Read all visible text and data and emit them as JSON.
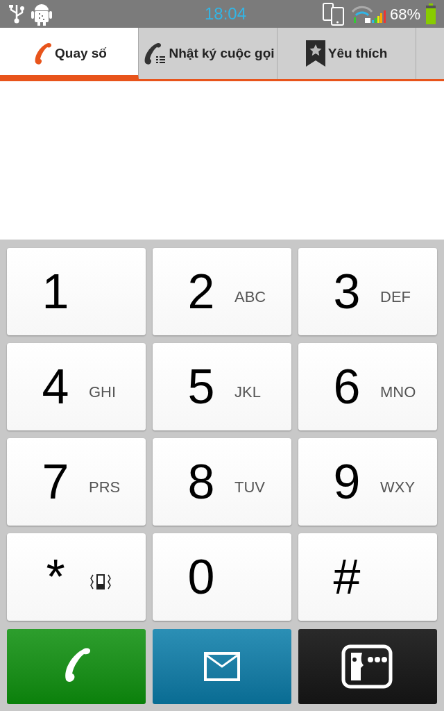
{
  "status_bar": {
    "time": "18:04",
    "battery": "68%"
  },
  "tabs": [
    {
      "label": "Quay số",
      "kind": "phone",
      "selected": true
    },
    {
      "label": "Nhật ký cuộc gọi",
      "kind": "log",
      "selected": false
    },
    {
      "label": "Yêu thích",
      "kind": "star",
      "selected": false
    }
  ],
  "keys": [
    {
      "digit": "1"
    },
    {
      "digit": "2",
      "letters": "ABC"
    },
    {
      "digit": "3",
      "letters": "DEF"
    },
    {
      "digit": "4",
      "letters": "GHI"
    },
    {
      "digit": "5",
      "letters": "JKL"
    },
    {
      "digit": "6",
      "letters": "MNO"
    },
    {
      "digit": "7",
      "letters": "PRS"
    },
    {
      "digit": "8",
      "letters": "TUV"
    },
    {
      "digit": "9",
      "letters": "WXY"
    },
    {
      "digit": "*",
      "kind": "vibrate"
    },
    {
      "digit": "0"
    },
    {
      "digit": "#"
    }
  ],
  "actions": [
    {
      "kind": "call"
    },
    {
      "kind": "message"
    },
    {
      "kind": "video"
    }
  ]
}
